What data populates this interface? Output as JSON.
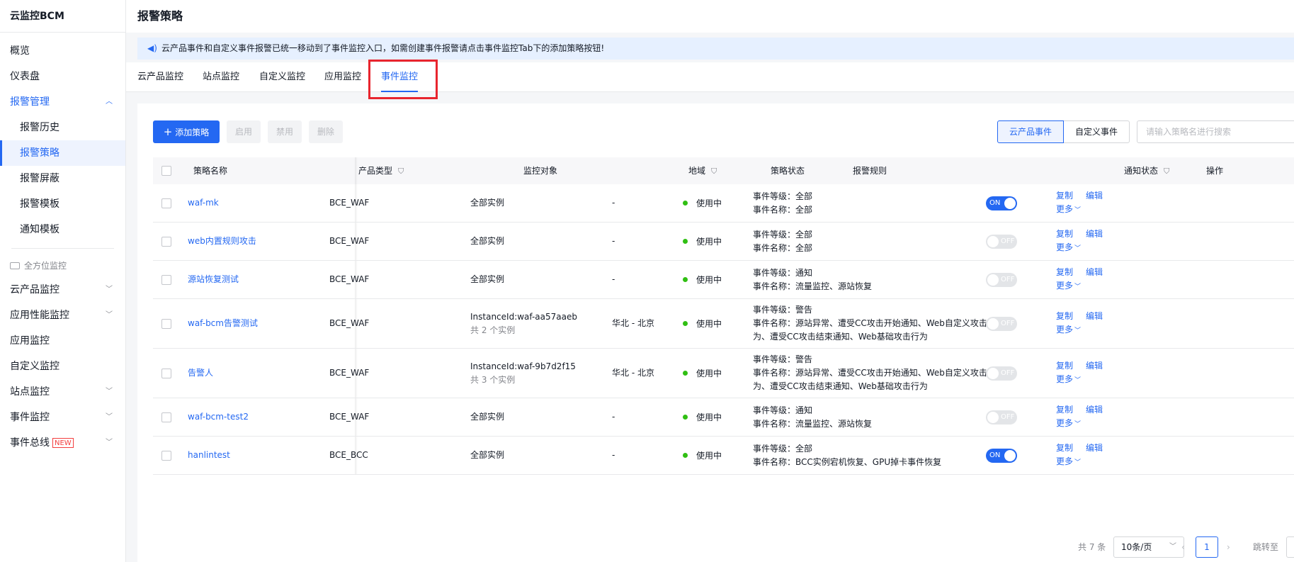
{
  "sidebar": {
    "brand": "云监控BCM",
    "top_items": [
      {
        "label": "概览"
      },
      {
        "label": "仪表盘"
      },
      {
        "label": "报警管理"
      }
    ],
    "alarm_sub_items": [
      {
        "label": "报警历史"
      },
      {
        "label": "报警策略"
      },
      {
        "label": "报警屏蔽"
      },
      {
        "label": "报警模板"
      },
      {
        "label": "通知模板"
      }
    ],
    "section_label": "全方位监控",
    "monitor_items": [
      {
        "label": "云产品监控"
      },
      {
        "label": "应用性能监控"
      },
      {
        "label": "应用监控"
      },
      {
        "label": "自定义监控"
      },
      {
        "label": "站点监控"
      },
      {
        "label": "事件监控"
      },
      {
        "label": "事件总线"
      }
    ],
    "new_badge": "NEW"
  },
  "header": {
    "title": "报警策略"
  },
  "notice": {
    "text": "云产品事件和自定义事件报警已统一移动到了事件监控入口，如需创建事件报警请点击事件监控Tab下的添加策略按钮!"
  },
  "tabs": [
    {
      "label": "云产品监控"
    },
    {
      "label": "站点监控"
    },
    {
      "label": "自定义监控"
    },
    {
      "label": "应用监控"
    },
    {
      "label": "事件监控"
    }
  ],
  "toolbar": {
    "add_label": "添加策略",
    "enable_label": "启用",
    "disable_label": "禁用",
    "delete_label": "删除",
    "seg_cloud": "云产品事件",
    "seg_custom": "自定义事件",
    "search_placeholder": "请输入策略名进行搜索"
  },
  "table": {
    "columns": {
      "name": "策略名称",
      "product": "产品类型",
      "target": "监控对象",
      "region": "地域",
      "status": "策略状态",
      "rule": "报警规则",
      "notify": "通知状态",
      "ops": "操作"
    },
    "rows": [
      {
        "name": "waf-mk",
        "product": "BCE_WAF",
        "target": "全部实例",
        "target_sub": "",
        "region": "-",
        "status": "使用中",
        "rule_level": "事件等级：全部",
        "rule_names": "事件名称：全部",
        "notify": true,
        "notify_label": "ON"
      },
      {
        "name": "web内置规则攻击",
        "product": "BCE_WAF",
        "target": "全部实例",
        "target_sub": "",
        "region": "-",
        "status": "使用中",
        "rule_level": "事件等级：全部",
        "rule_names": "事件名称：全部",
        "notify": false,
        "notify_label": "OFF"
      },
      {
        "name": "源站恢复测试",
        "product": "BCE_WAF",
        "target": "全部实例",
        "target_sub": "",
        "region": "-",
        "status": "使用中",
        "rule_level": "事件等级：通知",
        "rule_names": "事件名称：流量监控、源站恢复",
        "notify": false,
        "notify_label": "OFF"
      },
      {
        "name": "waf-bcm告警测试",
        "product": "BCE_WAF",
        "target": "InstanceId:waf-aa57aaeb",
        "target_sub": "共 2 个实例",
        "region": "华北 - 北京",
        "status": "使用中",
        "rule_level": "事件等级：警告",
        "rule_names": "事件名称：源站异常、遭受CC攻击开始通知、Web自定义攻击行",
        "rule_names2": "为、遭受CC攻击结束通知、Web基础攻击行为",
        "notify": false,
        "notify_label": "OFF"
      },
      {
        "name": "告警人",
        "product": "BCE_WAF",
        "target": "InstanceId:waf-9b7d2f15",
        "target_sub": "共 3 个实例",
        "region": "华北 - 北京",
        "status": "使用中",
        "rule_level": "事件等级：警告",
        "rule_names": "事件名称：源站异常、遭受CC攻击开始通知、Web自定义攻击行",
        "rule_names2": "为、遭受CC攻击结束通知、Web基础攻击行为",
        "notify": false,
        "notify_label": "OFF"
      },
      {
        "name": "waf-bcm-test2",
        "product": "BCE_WAF",
        "target": "全部实例",
        "target_sub": "",
        "region": "-",
        "status": "使用中",
        "rule_level": "事件等级：通知",
        "rule_names": "事件名称：流量监控、源站恢复",
        "notify": false,
        "notify_label": "OFF"
      },
      {
        "name": "hanlintest",
        "product": "BCE_BCC",
        "target": "全部实例",
        "target_sub": "",
        "region": "-",
        "status": "使用中",
        "rule_level": "事件等级：全部",
        "rule_names": "事件名称：BCC实例宕机恢复、GPU掉卡事件恢复",
        "notify": true,
        "notify_label": "ON"
      }
    ],
    "op_copy": "复制",
    "op_edit": "编辑",
    "op_more": "更多"
  },
  "pagination": {
    "total": "共 7 条",
    "page_size": "10条/页",
    "current_page": "1",
    "jump_label": "跳转至"
  },
  "colors": {
    "accent": "#2468f2",
    "status_ok": "#30bf13",
    "highlight": "#e8252e"
  }
}
